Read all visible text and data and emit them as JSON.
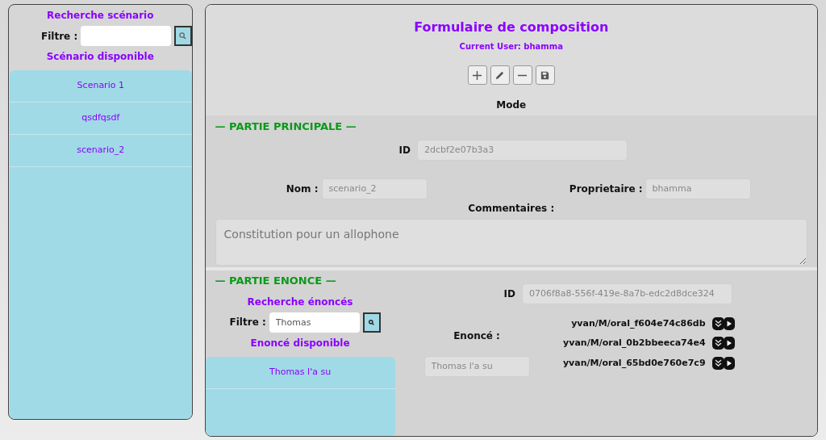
{
  "sidebar": {
    "title": "Recherche scénario",
    "filter_label": "Filtre :",
    "list_title": "Scénario disponible",
    "items": [
      {
        "label": "Scenario 1"
      },
      {
        "label": "qsdfqsdf"
      },
      {
        "label": "scenario_2"
      }
    ]
  },
  "form": {
    "title": "Formulaire de composition",
    "current_user": "Current User: bhamma",
    "toolbar": [
      {
        "kind": "add"
      },
      {
        "kind": "edit"
      },
      {
        "kind": "remove"
      },
      {
        "kind": "save"
      }
    ],
    "mode_label": "Mode",
    "principal": {
      "legend": "— PARTIE PRINCIPALE —",
      "id_label": "ID",
      "id_value": "2dcbf2e07b3a3",
      "name_label": "Nom :",
      "name_value": "scenario_2",
      "owner_label": "Proprietaire :",
      "owner_value": "bhamma",
      "comments_label": "Commentaires :",
      "comments_value": "Constitution pour un allophone"
    },
    "enonce": {
      "legend": "— PARTIE ENONCE —",
      "search_title": "Recherche énoncés",
      "filter_label": "Filtre :",
      "filter_value": "Thomas",
      "list_title": "Enoncé disponible",
      "items": [
        {
          "label": "Thomas l'a su"
        }
      ],
      "id_label": "ID",
      "id_value": "0706f8a8-556f-419e-8a7b-edc2d8dce324",
      "enonce_label": "Enoncé :",
      "enonce_value": "Thomas l'a su",
      "audios": [
        {
          "label": "yvan/M/oral_f604e74c86db"
        },
        {
          "label": "yvan/M/oral_0b2bbeeca74e4"
        },
        {
          "label": "yvan/M/oral_65bd0e760e7c9"
        }
      ]
    }
  }
}
